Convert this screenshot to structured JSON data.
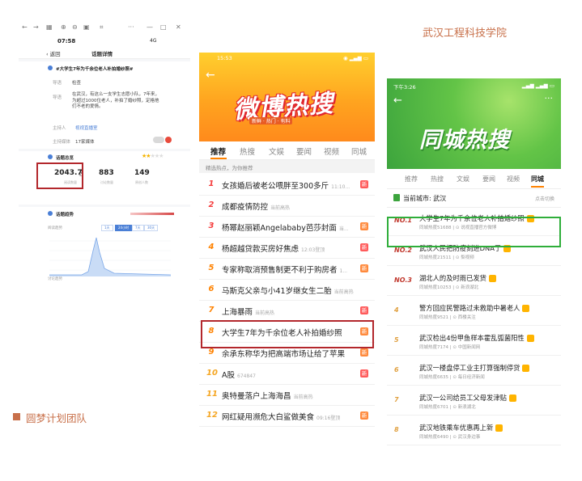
{
  "school_name": "武汉工程科技学院",
  "team_label": "圆梦计划团队",
  "colors": {
    "brand_accent": "#c8704a",
    "weibo_orange": "#ff8200",
    "weibo_red": "#e0262d",
    "tag_red": "#ff5b5b",
    "tag_orange": "#ffb400",
    "highlight_red": "#b3272c",
    "highlight_green": "#2fae3a",
    "city_green": "#3ca43d"
  },
  "phone1": {
    "status_time": "07:58",
    "status_right": "4G",
    "back_label": "返回",
    "header_title": "话题详情",
    "topic": "#大学生7年为千余位老人补拍婚纱照#",
    "rows": [
      {
        "label": "导语",
        "value": "检查"
      },
      {
        "label": "导语",
        "value": "在武汉，有这么一支学生志愿小队，7年来，为超过1000位老人，补拍了婚纱照，定格他们不老的爱情。"
      },
      {
        "label": "主持人",
        "value": "视视直播室"
      },
      {
        "label": "主持媒体",
        "value": "17家媒体"
      }
    ],
    "data_section_title": "话题总览",
    "stats": [
      {
        "value": "2043.7",
        "unit": "亿",
        "label": "阅读数量"
      },
      {
        "value": "883",
        "label": "讨论数量"
      },
      {
        "value": "149",
        "label": "原创人数"
      }
    ],
    "trend_title": "话题趋势",
    "trend_label": "阅读趋势",
    "trend_tabs": [
      "1天",
      "24小时",
      "7天",
      "30天"
    ],
    "bottom_label": "讨论趋势"
  },
  "phone2": {
    "status_time": "15:53",
    "banner_title": "微博热搜",
    "banner_sub": "新鲜 · 热门 · 有料",
    "tabs": [
      "推荐",
      "热搜",
      "文娱",
      "要闻",
      "视频",
      "同城"
    ],
    "hint": "精选热点，为你推荐",
    "items": [
      {
        "rank": "1",
        "title": "女孩婚后被老公喂胖至300多斤",
        "meta": "11:10...",
        "tag": "新"
      },
      {
        "rank": "2",
        "title": "成都疫情防控",
        "meta": "当前高热",
        "tag": ""
      },
      {
        "rank": "3",
        "title": "杨幂赵丽颖Angelababy芭莎封面",
        "meta": "当...",
        "tag": "新"
      },
      {
        "rank": "4",
        "title": "杨超越贷款买房好焦虑",
        "meta": "12:03登顶",
        "tag": "新"
      },
      {
        "rank": "5",
        "title": "专家称取消预售制更不利于购房者",
        "meta": "1...",
        "tag": "新"
      },
      {
        "rank": "6",
        "title": "马斯克父亲与小41岁继女生二胎",
        "meta": "当前高热",
        "tag": ""
      },
      {
        "rank": "7",
        "title": "上海暴雨",
        "meta": "当前高热",
        "tag": "新"
      },
      {
        "rank": "8",
        "title": "大学生7年为千余位老人补拍婚纱照",
        "meta": "",
        "tag": "新"
      },
      {
        "rank": "9",
        "title": "余承东称华为把高端市场让给了苹果",
        "meta": "",
        "tag": "新"
      },
      {
        "rank": "10",
        "title": "A股",
        "meta": "674847",
        "tag": "新"
      },
      {
        "rank": "11",
        "title": "奥特曼落户上海海昌",
        "meta": "当前高热",
        "tag": ""
      },
      {
        "rank": "12",
        "title": "网红疑用濒危大白鲨做美食",
        "meta": "09:16登顶",
        "tag": "新"
      }
    ]
  },
  "phone3": {
    "status_time": "下午3:26",
    "banner_title": "同城热搜",
    "tabs": [
      "推荐",
      "热搜",
      "文娱",
      "要闻",
      "视频",
      "同城"
    ],
    "current_city": "当前城市: 武汉",
    "switch_label": "点击切换",
    "items": [
      {
        "rank": "NO.1",
        "title": "大学生7年为千余位老人补拍婚纱照",
        "meta": "同城热度51688 | ⊙ 说视直播官方微博"
      },
      {
        "rank": "NO.2",
        "title": "武汉人民把防疫刻进DNA了",
        "meta": "同城热度21511 | ⊙ 梨视频"
      },
      {
        "rank": "NO.3",
        "title": "湖北人的及时雨已发货",
        "meta": "同城热度10253 | ⊙ 新浪湖北"
      },
      {
        "rank": "4",
        "title": "警方回应民警路过未救助中暑老人",
        "meta": "同城热度9521 | ⊙ 西楼关注"
      },
      {
        "rank": "5",
        "title": "武汉检出4份甲鱼样本霍乱弧菌阳性",
        "meta": "同城热度7174 | ⊙ 中国新闻网"
      },
      {
        "rank": "6",
        "title": "武汉一楼盘停工业主打算强制停贷",
        "meta": "同城热度6635 | ⊙ 每日经济新闻"
      },
      {
        "rank": "7",
        "title": "武汉一公司给员工父母发津贴",
        "meta": "同城热度6701 | ⊙ 新浪湖北"
      },
      {
        "rank": "8",
        "title": "武汉地铁乘车优惠再上新",
        "meta": "同城热度6490 | ⊙ 武汉身边事"
      }
    ]
  }
}
